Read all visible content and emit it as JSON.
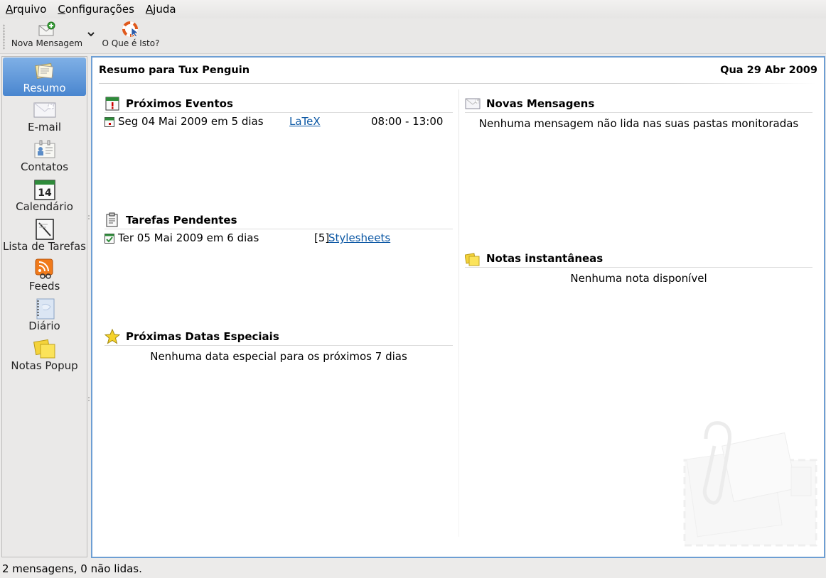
{
  "menu": [
    {
      "accel": "A",
      "rest": "rquivo"
    },
    {
      "accel": "C",
      "rest": "onfigurações"
    },
    {
      "accel": "A",
      "rest": "juda"
    }
  ],
  "toolbar": {
    "new_message": "Nova Mensagem",
    "what_is_this": "O Que é Isto?"
  },
  "sidebar": {
    "items": [
      {
        "label": "Resumo",
        "icon": "summary-icon"
      },
      {
        "label": "E-mail",
        "icon": "mail-icon"
      },
      {
        "label": "Contatos",
        "icon": "contacts-icon"
      },
      {
        "label": "Calendário",
        "icon": "calendar-icon"
      },
      {
        "label": "Lista de Tarefas",
        "icon": "todo-icon"
      },
      {
        "label": "Feeds",
        "icon": "feeds-icon"
      },
      {
        "label": "Diário",
        "icon": "journal-icon"
      },
      {
        "label": "Notas Popup",
        "icon": "notes-icon"
      }
    ],
    "calendar_day": "14"
  },
  "summary": {
    "title": "Resumo para Tux Penguin",
    "date": "Qua 29 Abr 2009",
    "events": {
      "title": "Próximos Eventos",
      "items": [
        {
          "date": "Seg 04 Mai 2009",
          "relative": "em 5 dias",
          "name": "LaTeX",
          "time": "08:00 - 13:00"
        }
      ]
    },
    "tasks": {
      "title": "Tarefas Pendentes",
      "items": [
        {
          "date": "Ter 05 Mai 2009",
          "relative": "em 6 dias",
          "priority": "[5]",
          "name": "Stylesheets"
        }
      ]
    },
    "special_dates": {
      "title": "Próximas Datas Especiais",
      "empty": "Nenhuma data especial para os próximos 7 dias"
    },
    "mail": {
      "title": "Novas Mensagens",
      "empty": "Nenhuma mensagem não lida nas suas pastas monitoradas"
    },
    "notes": {
      "title": "Notas instantâneas",
      "empty": "Nenhuma nota disponível"
    }
  },
  "status": "2 mensagens, 0 não lidas.",
  "colors": {
    "accent": "#4a86cf",
    "link": "#0b57a4",
    "panel_border": "#6d9ed3"
  }
}
